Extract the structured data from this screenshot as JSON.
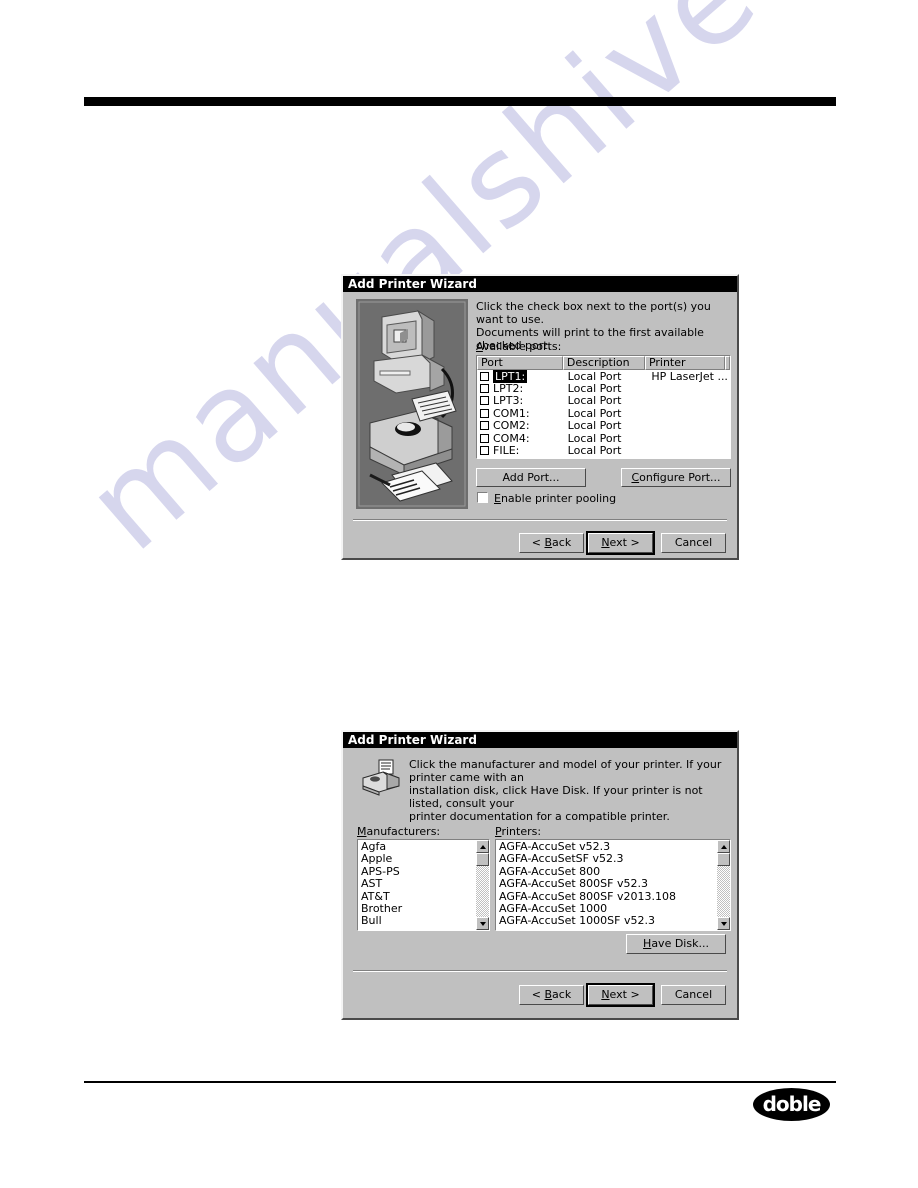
{
  "page": {
    "watermark": "manualshive.com",
    "logo_text": "doble"
  },
  "dialog_ports": {
    "title": "Add Printer Wizard",
    "instruction_line1": "Click the check box next to the port(s) you want to use.",
    "instruction_line2": "Documents will print to the first available checked port.",
    "available_ports_label": "Available ports:",
    "columns": [
      "Port",
      "Description",
      "Printer"
    ],
    "rows": [
      {
        "port": "LPT1:",
        "description": "Local Port",
        "printer": "HP LaserJet ...",
        "checked": false,
        "selected": true
      },
      {
        "port": "LPT2:",
        "description": "Local Port",
        "printer": "",
        "checked": false,
        "selected": false
      },
      {
        "port": "LPT3:",
        "description": "Local Port",
        "printer": "",
        "checked": false,
        "selected": false
      },
      {
        "port": "COM1:",
        "description": "Local Port",
        "printer": "",
        "checked": false,
        "selected": false
      },
      {
        "port": "COM2:",
        "description": "Local Port",
        "printer": "",
        "checked": false,
        "selected": false
      },
      {
        "port": "COM4:",
        "description": "Local Port",
        "printer": "",
        "checked": false,
        "selected": false
      },
      {
        "port": "FILE:",
        "description": "Local Port",
        "printer": "",
        "checked": false,
        "selected": false
      }
    ],
    "add_port_label": "Add Port...",
    "configure_port_label": "Configure Port...",
    "enable_pooling_label": "Enable printer pooling",
    "enable_pooling_checked": false,
    "back_label": "< Back",
    "next_label": "Next >",
    "cancel_label": "Cancel",
    "illustration_name": "computer-printer-documents-illustration"
  },
  "dialog_models": {
    "title": "Add Printer Wizard",
    "instruction_line1": "Click the manufacturer and model of your printer.  If your printer came with an",
    "instruction_line2": "installation disk, click Have Disk.  If your printer is not listed, consult your",
    "instruction_line3": "printer documentation for a compatible printer.",
    "manufacturers_label": "Manufacturers:",
    "printers_label": "Printers:",
    "manufacturers": [
      {
        "name": "Agfa",
        "selected": true
      },
      {
        "name": "Apple",
        "selected": false
      },
      {
        "name": "APS-PS",
        "selected": false
      },
      {
        "name": "AST",
        "selected": false
      },
      {
        "name": "AT&T",
        "selected": false
      },
      {
        "name": "Brother",
        "selected": false
      },
      {
        "name": "Bull",
        "selected": false
      }
    ],
    "printers": [
      {
        "name": "AGFA-AccuSet v52.3",
        "selected": true
      },
      {
        "name": "AGFA-AccuSetSF v52.3",
        "selected": false
      },
      {
        "name": "AGFA-AccuSet 800",
        "selected": false
      },
      {
        "name": "AGFA-AccuSet 800SF v52.3",
        "selected": false
      },
      {
        "name": "AGFA-AccuSet 800SF v2013.108",
        "selected": false
      },
      {
        "name": "AGFA-AccuSet 1000",
        "selected": false
      },
      {
        "name": "AGFA-AccuSet 1000SF v52.3",
        "selected": false
      }
    ],
    "have_disk_label": "Have Disk...",
    "back_label": "< Back",
    "next_label": "Next >",
    "cancel_label": "Cancel",
    "icon_name": "printer-icon"
  }
}
